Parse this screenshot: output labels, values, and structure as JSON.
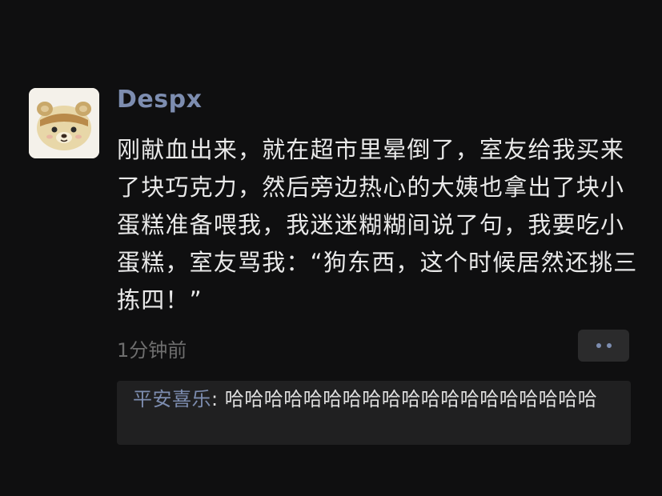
{
  "post": {
    "username": "Despx",
    "content": "刚献血出来，就在超市里晕倒了，室友给我买来了块巧克力，然后旁边热心的大姨也拿出了块小蛋糕准备喂我，我迷迷糊糊间说了句，我要吃小蛋糕，室友骂我：“狗东西，这个时候居然还挑三拣四！”",
    "timestamp": "1分钟前"
  },
  "actions": {
    "more_icon": "more-dots-icon"
  },
  "comments": [
    {
      "author": "平安喜乐",
      "separator": ": ",
      "text": "哈哈哈哈哈哈哈哈哈哈哈哈哈哈哈哈哈哈哈"
    }
  ],
  "colors": {
    "background": "#0f0f10",
    "link_name": "#7d8db0",
    "text": "#e9e9e9",
    "muted": "#6e6e6e"
  }
}
